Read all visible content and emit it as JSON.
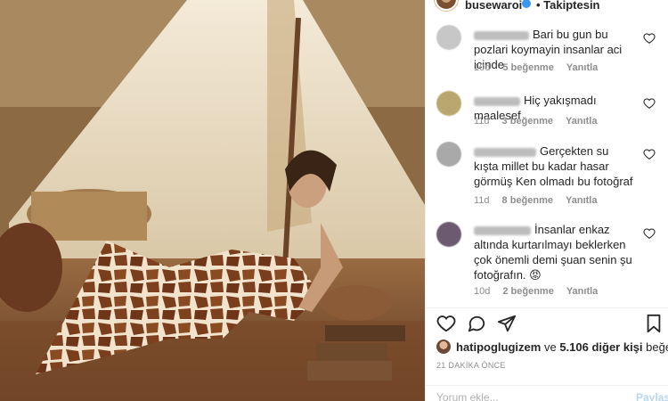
{
  "header": {
    "username": "busewaroi",
    "follow_label": "• Takiptesin"
  },
  "comments": [
    {
      "text": "Bari bu gun bu pozlari koymayin insanlar aci icinde",
      "age": "10d",
      "likes": "5 beğenme",
      "reply": "Yanıtla",
      "avatar_color": "#c7c7c7"
    },
    {
      "text": "Hiç yakışmadı maalesef",
      "age": "11d",
      "likes": "3 beğenme",
      "reply": "Yanıtla",
      "avatar_color": "#b8a86e"
    },
    {
      "text": "Gerçekten su kışta millet bu kadar hasar görmüş Ken olmadı bu fotoğraf",
      "age": "11d",
      "likes": "8 beğenme",
      "reply": "Yanıtla",
      "avatar_color": "#a9a9a9"
    },
    {
      "text": "İnsanlar enkaz altında kurtarılmayı beklerken çok önemli demi şuan senin şu fotoğrafın. 😡",
      "age": "10d",
      "likes": "2 beğenme",
      "reply": "Yanıtla",
      "avatar_color": "#6b5a70"
    }
  ],
  "actions": {
    "icons": [
      "heart-icon",
      "comment-icon",
      "share-icon",
      "bookmark-icon"
    ]
  },
  "likes": {
    "first_user": "hatipoglugizem",
    "connector": " ve ",
    "others": "5.106 diğer kişi",
    "suffix": " beğendi"
  },
  "timestamp": "21 DAKİKA ÖNCE",
  "add_comment": {
    "placeholder": "Yorum ekle...",
    "post_label": "Paylaş"
  },
  "colors": {
    "meta_gray": "#8e8e8e",
    "text": "#262626",
    "link_blue_disabled": "#b8d7f5",
    "verified_blue": "#3897f0"
  }
}
